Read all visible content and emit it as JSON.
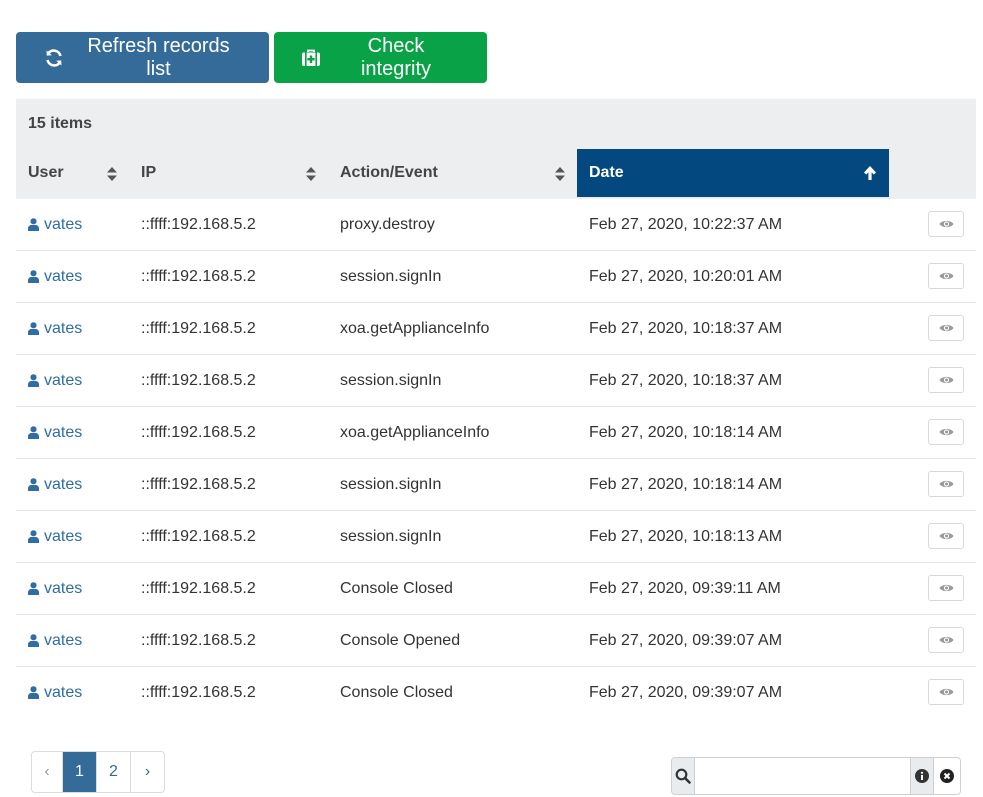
{
  "toolbar": {
    "refresh_label": "Refresh records list",
    "check_label": "Check integrity"
  },
  "table": {
    "count_label": "15 items",
    "columns": [
      "User",
      "IP",
      "Action/Event",
      "Date"
    ],
    "sorted_column": "Date",
    "sort_direction": "ascending",
    "rows": [
      {
        "user": "vates",
        "ip": "::ffff:192.168.5.2",
        "action": "proxy.destroy",
        "date": "Feb 27, 2020, 10:22:37 AM"
      },
      {
        "user": "vates",
        "ip": "::ffff:192.168.5.2",
        "action": "session.signIn",
        "date": "Feb 27, 2020, 10:20:01 AM"
      },
      {
        "user": "vates",
        "ip": "::ffff:192.168.5.2",
        "action": "xoa.getApplianceInfo",
        "date": "Feb 27, 2020, 10:18:37 AM"
      },
      {
        "user": "vates",
        "ip": "::ffff:192.168.5.2",
        "action": "session.signIn",
        "date": "Feb 27, 2020, 10:18:37 AM"
      },
      {
        "user": "vates",
        "ip": "::ffff:192.168.5.2",
        "action": "xoa.getApplianceInfo",
        "date": "Feb 27, 2020, 10:18:14 AM"
      },
      {
        "user": "vates",
        "ip": "::ffff:192.168.5.2",
        "action": "session.signIn",
        "date": "Feb 27, 2020, 10:18:14 AM"
      },
      {
        "user": "vates",
        "ip": "::ffff:192.168.5.2",
        "action": "session.signIn",
        "date": "Feb 27, 2020, 10:18:13 AM"
      },
      {
        "user": "vates",
        "ip": "::ffff:192.168.5.2",
        "action": "Console Closed",
        "date": "Feb 27, 2020, 09:39:11 AM"
      },
      {
        "user": "vates",
        "ip": "::ffff:192.168.5.2",
        "action": "Console Opened",
        "date": "Feb 27, 2020, 09:39:07 AM"
      },
      {
        "user": "vates",
        "ip": "::ffff:192.168.5.2",
        "action": "Console Closed",
        "date": "Feb 27, 2020, 09:39:07 AM"
      }
    ]
  },
  "pagination": {
    "prev": "‹",
    "pages": [
      "1",
      "2"
    ],
    "current": "1",
    "next": "›"
  },
  "search": {
    "value": "",
    "placeholder": ""
  },
  "colors": {
    "primary": "#346b98",
    "success": "#0aa246",
    "active_header": "#03487e",
    "header_bg": "#edeef0",
    "link": "#2f6da4"
  },
  "icons": {
    "refresh": "refresh-icon",
    "integrity": "medkit-icon",
    "user": "user-icon",
    "sort": "sort-icon",
    "sort_up": "arrow-up-icon",
    "view": "eye-icon",
    "search": "search-icon",
    "info": "info-icon",
    "clear": "close-circle-icon"
  }
}
